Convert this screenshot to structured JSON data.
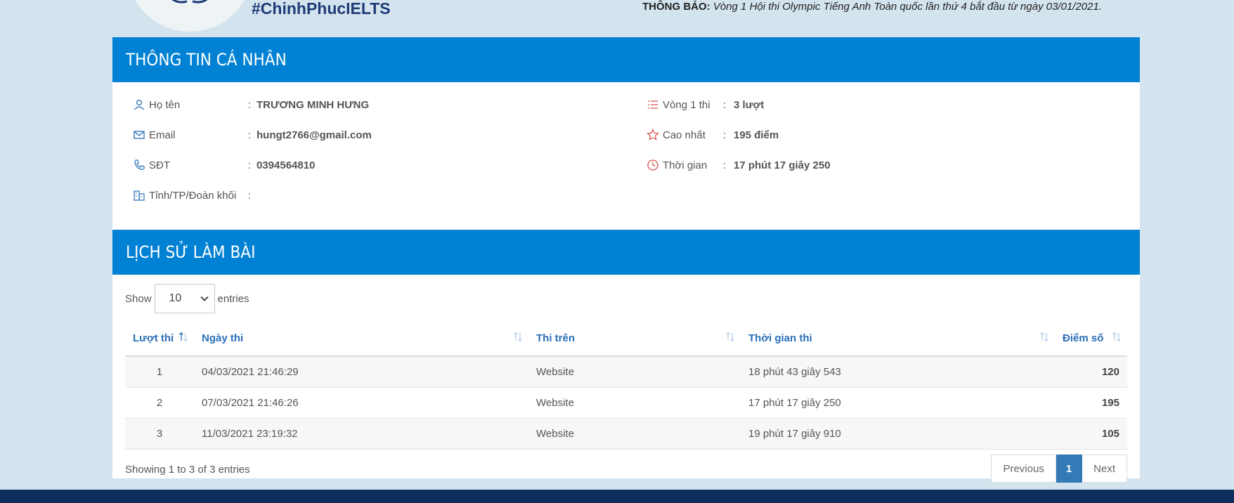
{
  "header": {
    "hashtag": "#ChinhPhucIELTS",
    "notice_label": "THÔNG BÁO:",
    "notice_text": " Vòng 1 Hội thi Olympic Tiếng Anh Toàn quốc lần thứ 4 bắt đầu từ ngày 03/01/2021."
  },
  "personal_info": {
    "title": "THÔNG TIN CÁ NHÂN",
    "left": [
      {
        "icon": "user-icon",
        "label": "Họ tên",
        "value": "TRƯƠNG MINH HƯNG"
      },
      {
        "icon": "envelope-icon",
        "label": "Email",
        "value": "hungt2766@gmail.com"
      },
      {
        "icon": "phone-icon",
        "label": "SĐT",
        "value": "0394564810"
      },
      {
        "icon": "building-icon",
        "label": "Tỉnh/TP/Đoàn khối",
        "value": ""
      }
    ],
    "right": [
      {
        "icon": "list-icon",
        "label": "Vòng 1 thi",
        "value": "3 lượt"
      },
      {
        "icon": "star-icon",
        "label": "Cao nhất",
        "value": "195 điểm"
      },
      {
        "icon": "clock-icon",
        "label": "Thời gian",
        "value": "17 phút 17 giây 250"
      }
    ],
    "colon": ":"
  },
  "history": {
    "title": "LỊCH SỬ LÀM BÀI",
    "show_label": "Show",
    "page_size": "10",
    "entries_label": "entries",
    "columns": [
      "Lượt thi",
      "Ngày thi",
      "Thi trên",
      "Thời gian thi",
      "Điểm số"
    ],
    "rows": [
      {
        "attempt": "1",
        "date": "04/03/2021 21:46:29",
        "platform": "Website",
        "duration": "18 phút 43 giây 543",
        "score": "120"
      },
      {
        "attempt": "2",
        "date": "07/03/2021 21:46:26",
        "platform": "Website",
        "duration": "17 phút 17 giây 250",
        "score": "195"
      },
      {
        "attempt": "3",
        "date": "11/03/2021 23:19:32",
        "platform": "Website",
        "duration": "19 phút 17 giây 910",
        "score": "105"
      }
    ],
    "summary": "Showing 1 to 3 of 3 entries",
    "pagination": {
      "previous": "Previous",
      "current": "1",
      "next": "Next"
    }
  },
  "colors": {
    "section_header": "#0081d4",
    "page_bg": "#d4e4ee",
    "column_header_text": "#2a6fb8",
    "active_page": "#337ab7",
    "icon_accent": "#d9534f",
    "footer": "#0d2d5e"
  }
}
